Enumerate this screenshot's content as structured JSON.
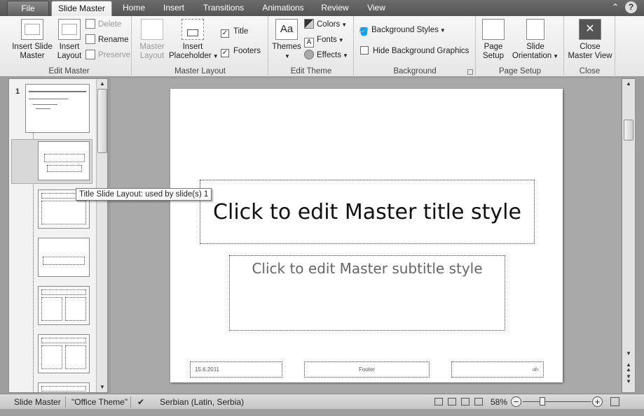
{
  "tabs": {
    "file": "File",
    "slide_master": "Slide Master",
    "home": "Home",
    "insert": "Insert",
    "transitions": "Transitions",
    "animations": "Animations",
    "review": "Review",
    "view": "View"
  },
  "help_icon": "?",
  "ribbon": {
    "edit_master": {
      "label": "Edit Master",
      "insert_slide_master_1": "Insert Slide",
      "insert_slide_master_2": "Master",
      "insert_layout_1": "Insert",
      "insert_layout_2": "Layout",
      "delete": "Delete",
      "rename": "Rename",
      "preserve": "Preserve"
    },
    "master_layout": {
      "label": "Master Layout",
      "master_layout_1": "Master",
      "master_layout_2": "Layout",
      "insert_placeholder_1": "Insert",
      "insert_placeholder_2": "Placeholder",
      "title": "Title",
      "footers": "Footers",
      "title_checked": true,
      "footers_checked": true
    },
    "edit_theme": {
      "label": "Edit Theme",
      "themes": "Themes",
      "themes_icon_text": "Aa",
      "colors": "Colors",
      "fonts": "Fonts",
      "effects": "Effects"
    },
    "background": {
      "label": "Background",
      "background_styles": "Background Styles",
      "hide_background_graphics": "Hide Background Graphics"
    },
    "page_setup": {
      "label": "Page Setup",
      "page_setup_1": "Page",
      "page_setup_2": "Setup",
      "slide_orientation_1": "Slide",
      "slide_orientation_2": "Orientation"
    },
    "close": {
      "label": "Close",
      "close_master_view_1": "Close",
      "close_master_view_2": "Master View"
    }
  },
  "thumbnails": {
    "master_number": "1",
    "tooltip": "Title Slide Layout: used by slide(s) 1"
  },
  "slide": {
    "title": "Click to edit Master title style",
    "subtitle": "Click to edit Master subtitle style",
    "date": "15.6.2011",
    "footer": "Footer",
    "slide_number": "‹#›"
  },
  "status": {
    "view_name": "Slide Master",
    "theme": "\"Office Theme\"",
    "language": "Serbian (Latin, Serbia)",
    "zoom": "58%"
  }
}
